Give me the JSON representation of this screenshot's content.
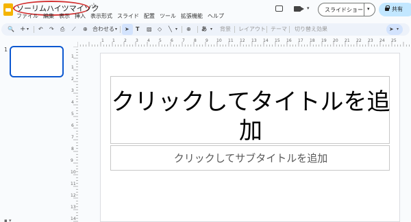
{
  "document": {
    "title": "ソーリムハイツマイソク"
  },
  "menu": [
    "ファイル",
    "編集",
    "表示",
    "挿入",
    "表示形式",
    "スライド",
    "配置",
    "ツール",
    "拡張機能",
    "ヘルプ"
  ],
  "header": {
    "slideshow_label": "スライドショー",
    "share_label": "共有"
  },
  "toolbar": {
    "search": "🔍",
    "new_slide": "+",
    "undo": "↶",
    "redo": "↷",
    "print": "⎙",
    "paint_format": "⟋",
    "zoom_label": "合わせる",
    "text_box": "T",
    "image": "▨",
    "shapes": "◇",
    "line": "╲",
    "comment": "⊕",
    "input_tools": "あ",
    "background": "背景",
    "layout": "レイアウト",
    "theme": "テーマ",
    "transition": "切り替え効果"
  },
  "filmstrip": {
    "slides": [
      {
        "number": "1"
      }
    ]
  },
  "slide": {
    "title_placeholder": "クリックしてタイトルを追加",
    "subtitle_placeholder": "クリックしてサブタイトルを追加"
  },
  "rulers": {
    "horizontal": [
      "1",
      "1",
      "2",
      "3",
      "4",
      "5",
      "6",
      "7",
      "8",
      "9",
      "10",
      "11",
      "12",
      "13",
      "14",
      "15",
      "16",
      "17",
      "18",
      "19",
      "20",
      "21",
      "22",
      "23",
      "24",
      "25"
    ],
    "vertical": [
      "1",
      "1",
      "2",
      "3",
      "4",
      "5",
      "6",
      "7",
      "8",
      "9",
      "10",
      "11",
      "12",
      "13",
      "14"
    ]
  }
}
